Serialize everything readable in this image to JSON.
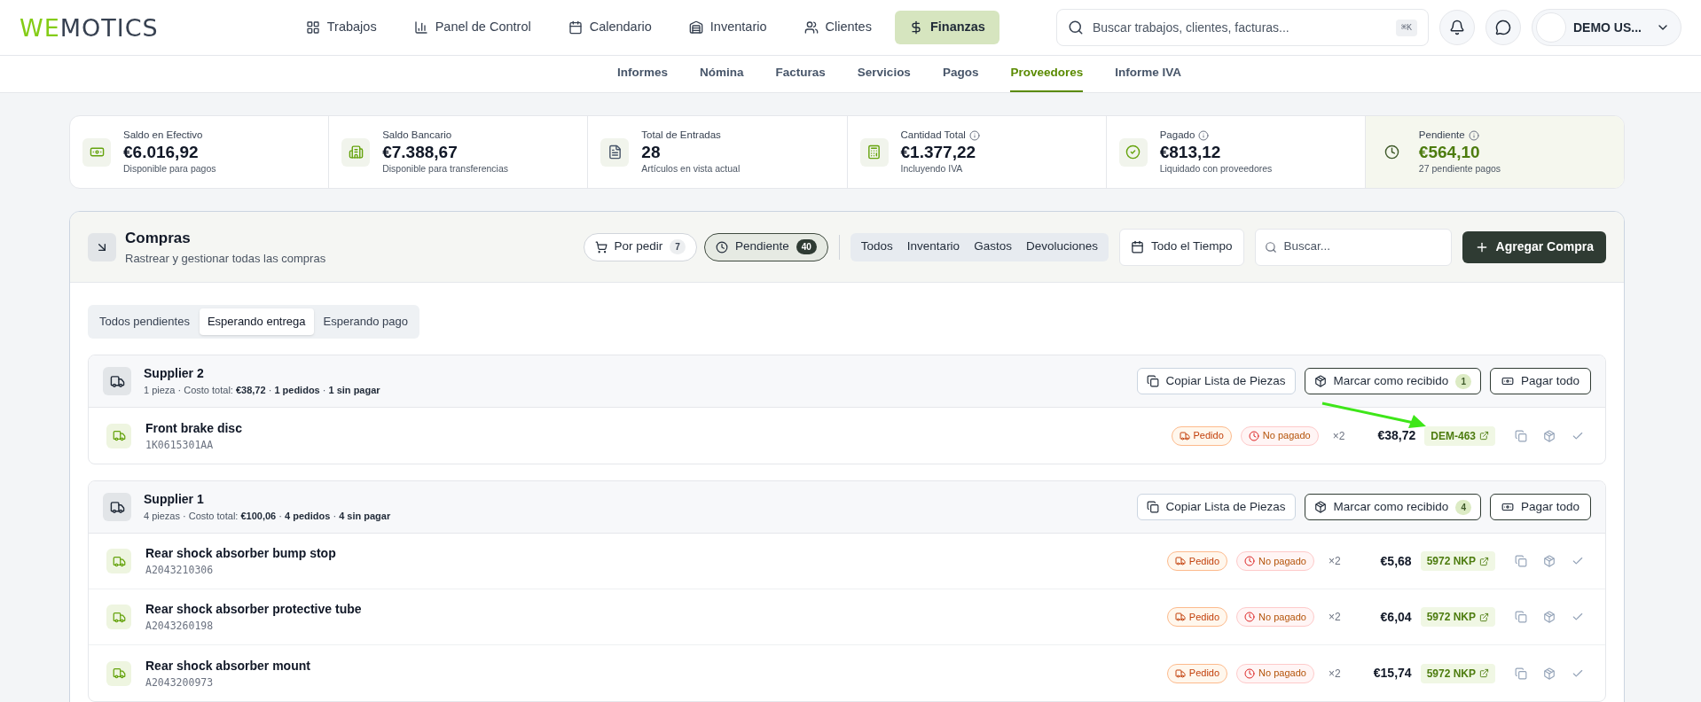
{
  "logo": {
    "accent": "WE",
    "rest": "MOTICS"
  },
  "nav": [
    {
      "label": "Trabajos",
      "selected": false
    },
    {
      "label": "Panel de Control",
      "selected": false
    },
    {
      "label": "Calendario",
      "selected": false
    },
    {
      "label": "Inventario",
      "selected": false
    },
    {
      "label": "Clientes",
      "selected": false
    },
    {
      "label": "Finanzas",
      "selected": true
    }
  ],
  "search": {
    "placeholder": "Buscar trabajos, clientes, facturas...",
    "shortcut": "⌘K"
  },
  "user": {
    "name": "DEMO US..."
  },
  "subnav": [
    {
      "label": "Informes",
      "selected": false
    },
    {
      "label": "Nómina",
      "selected": false
    },
    {
      "label": "Facturas",
      "selected": false
    },
    {
      "label": "Servicios",
      "selected": false
    },
    {
      "label": "Pagos",
      "selected": false
    },
    {
      "label": "Proveedores",
      "selected": true
    },
    {
      "label": "Informe IVA",
      "selected": false
    }
  ],
  "stats": [
    {
      "label": "Saldo en Efectivo",
      "info": false,
      "value": "€6.016,92",
      "caption": "Disponible para pagos",
      "highlighted": false
    },
    {
      "label": "Saldo Bancario",
      "info": false,
      "value": "€7.388,67",
      "caption": "Disponible para transferencias",
      "highlighted": false
    },
    {
      "label": "Total de Entradas",
      "info": false,
      "value": "28",
      "caption": "Artículos en vista actual",
      "highlighted": false
    },
    {
      "label": "Cantidad Total",
      "info": true,
      "value": "€1.377,22",
      "caption": "Incluyendo IVA",
      "highlighted": false
    },
    {
      "label": "Pagado",
      "info": true,
      "value": "€813,12",
      "caption": "Liquidado con proveedores",
      "highlighted": false
    },
    {
      "label": "Pendiente",
      "info": true,
      "value": "€564,10",
      "caption": "27 pendiente pagos",
      "highlighted": true
    }
  ],
  "purchases": {
    "title": "Compras",
    "subtitle": "Rastrear y gestionar todas las compras",
    "filters": [
      {
        "label": "Por pedir",
        "count": "7",
        "selected": false
      },
      {
        "label": "Pendiente",
        "count": "40",
        "selected": true
      }
    ],
    "categories": [
      {
        "label": "Todos",
        "selected": false
      },
      {
        "label": "Inventario",
        "selected": false
      },
      {
        "label": "Gastos",
        "selected": false
      },
      {
        "label": "Devoluciones",
        "selected": false
      }
    ],
    "period": "Todo el Tiempo",
    "search_placeholder": "Buscar...",
    "add_button": "Agregar Compra",
    "subtabs": [
      {
        "label": "Todos pendientes",
        "selected": false
      },
      {
        "label": "Esperando entrega",
        "selected": true
      },
      {
        "label": "Esperando pago",
        "selected": false
      }
    ],
    "suppliers": [
      {
        "name": "Supplier 2",
        "summary": "1 pieza · Costo total: **€38,72** · **1 pedidos** · **1 sin pagar**",
        "copy_button": "Copiar Lista de Piezas",
        "receive_button": "Marcar como recibido",
        "receive_count": "1",
        "pay_button": "Pagar todo",
        "items": [
          {
            "name": "Front brake disc",
            "code": "1K0615301AA",
            "status": "Pedido",
            "payment": "No pagado",
            "qty": "×2",
            "price": "€38,72",
            "ref": "DEM-463"
          }
        ]
      },
      {
        "name": "Supplier 1",
        "summary": "4 piezas · Costo total: **€100,06** · **4 pedidos** · **4 sin pagar**",
        "copy_button": "Copiar Lista de Piezas",
        "receive_button": "Marcar como recibido",
        "receive_count": "4",
        "pay_button": "Pagar todo",
        "items": [
          {
            "name": "Rear shock absorber bump stop",
            "code": "A2043210306",
            "status": "Pedido",
            "payment": "No pagado",
            "qty": "×2",
            "price": "€5,68",
            "ref": "5972 NKP"
          },
          {
            "name": "Rear shock absorber protective tube",
            "code": "A2043260198",
            "status": "Pedido",
            "payment": "No pagado",
            "qty": "×2",
            "price": "€6,04",
            "ref": "5972 NKP"
          },
          {
            "name": "Rear shock absorber mount",
            "code": "A2043200973",
            "status": "Pedido",
            "payment": "No pagado",
            "qty": "×2",
            "price": "€15,74",
            "ref": "5972 NKP"
          }
        ]
      }
    ]
  }
}
